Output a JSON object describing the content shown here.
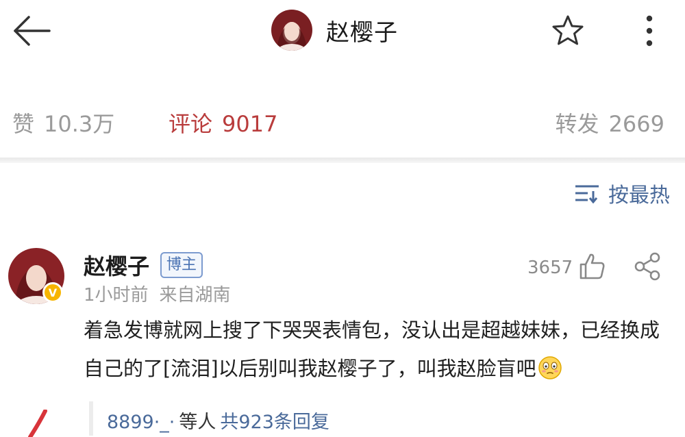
{
  "header": {
    "title": "赵樱子"
  },
  "stats": {
    "likes_label": "赞",
    "likes_value": "10.3万",
    "comments_label": "评论",
    "comments_value": "9017",
    "reposts_label": "转发",
    "reposts_value": "2669"
  },
  "sort": {
    "label": "按最热"
  },
  "comment": {
    "author": "赵樱子",
    "badge": "博主",
    "time": "1小时前",
    "source": "来自湖南",
    "like_count": "3657",
    "text": "着急发博就网上搜了下哭哭表情包，没认出是超越妹妹，已经换成自己的了[流泪]以后别叫我赵樱子了，叫我赵脸盲吧",
    "replies_user": "8899·_·",
    "replies_mid": "等人",
    "replies_count": "共923条回复"
  },
  "colors": {
    "accent_red": "#b93c3c",
    "link_blue": "#4a6a9a",
    "muted_gray": "#9a9a9a",
    "badge_blue": "#4a73b3",
    "verified_gold": "#f7b500"
  },
  "icons": {
    "back": "arrow-left-icon",
    "favorite": "star-outline-icon",
    "more": "vertical-dots-icon",
    "sort": "sort-lines-icon",
    "like": "thumbs-up-icon",
    "share": "share-icon",
    "emoji": "embarrassed-face-icon",
    "verified": "verified-v-icon"
  }
}
